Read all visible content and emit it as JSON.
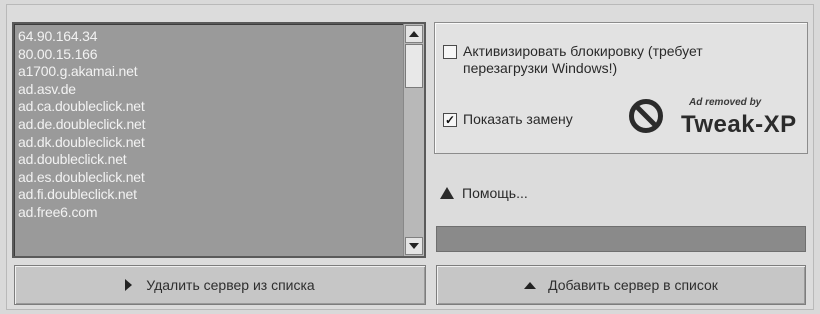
{
  "servers": [
    "64.90.164.34",
    "80.00.15.166",
    "a1700.g.akamai.net",
    "ad.asv.de",
    "ad.ca.doubleclick.net",
    "ad.de.doubleclick.net",
    "ad.dk.doubleclick.net",
    "ad.doubleclick.net",
    "ad.es.doubleclick.net",
    "ad.fi.doubleclick.net",
    "ad.free6.com"
  ],
  "options": {
    "activate_block_label": "Активизировать блокировку (требует перезагрузки Windows!)",
    "activate_block_checked": false,
    "show_replacement_label": "Показать замену",
    "show_replacement_checked": true
  },
  "ad_badge": {
    "small_text": "Ad removed by",
    "brand_text": "Tweak-XP"
  },
  "help_label": "Помощь...",
  "buttons": {
    "delete_server": "Удалить сервер из списка",
    "add_server": "Добавить сервер в список"
  },
  "icons": {
    "help": "warning-icon",
    "delete": "play-icon",
    "add": "eject-icon",
    "ad_removed": "no-entry-icon"
  }
}
